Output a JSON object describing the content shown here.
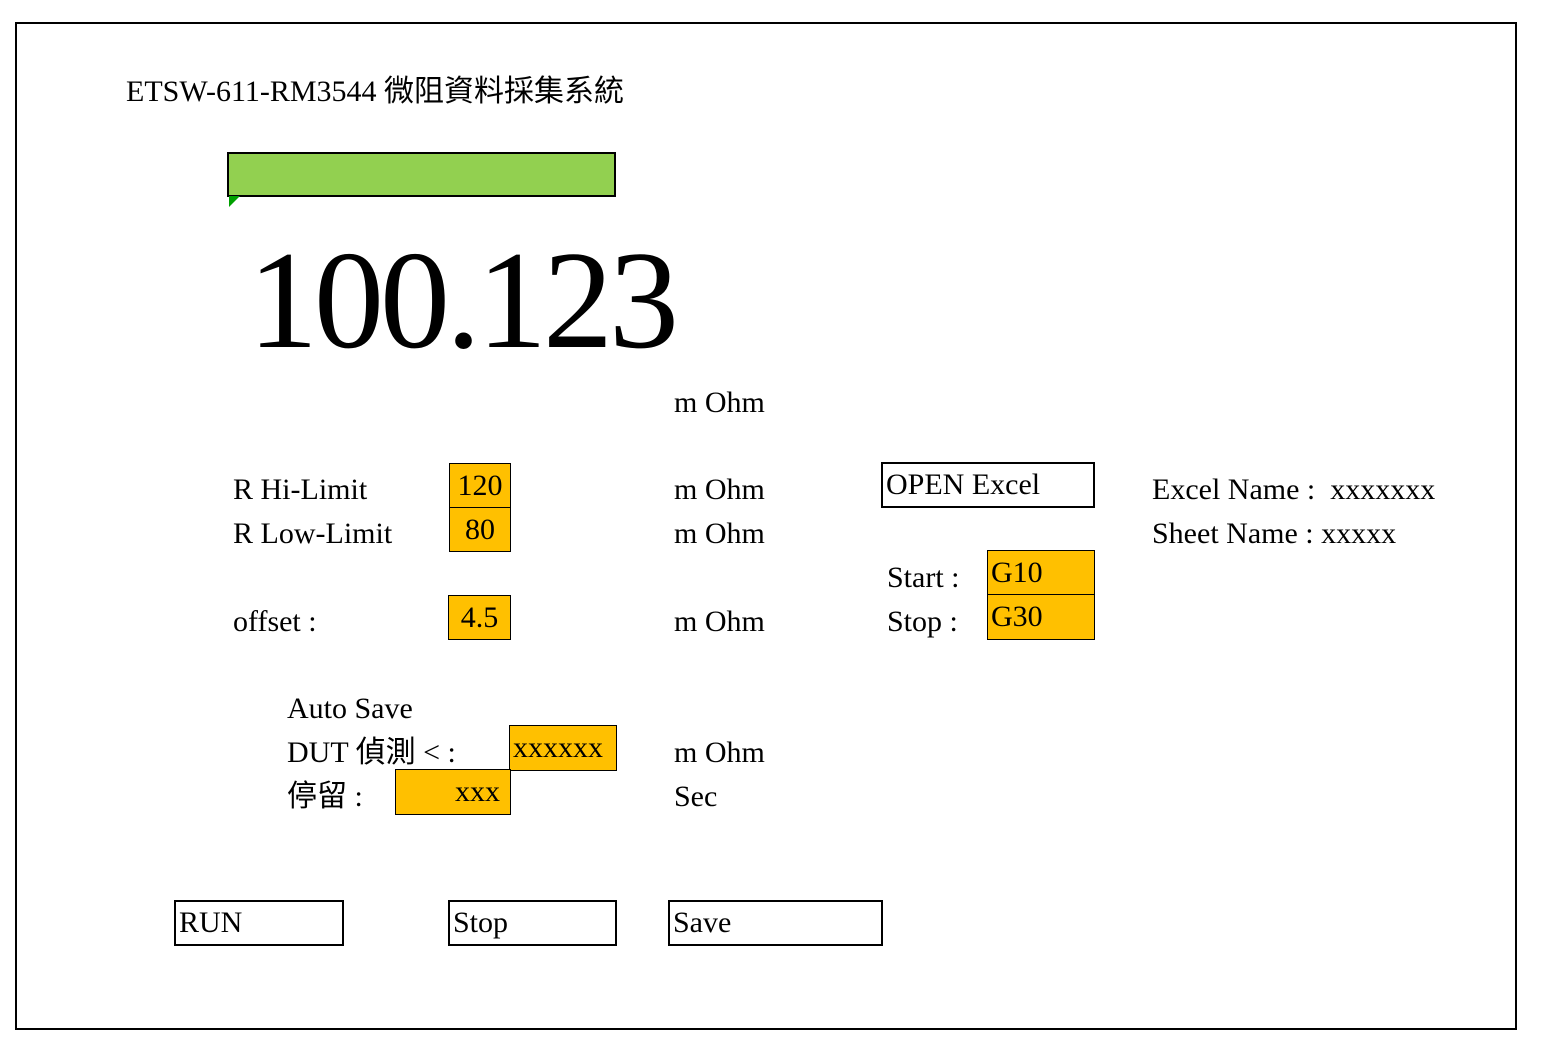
{
  "app": {
    "title": "ETSW-611-RM3544 微阻資料採集系統"
  },
  "colors": {
    "status_ok": "#92d050",
    "input_fill": "#ffc000",
    "indicator": "#00a000"
  },
  "measurement": {
    "value": "100.123",
    "unit": "m Ohm"
  },
  "limits": {
    "hi_label": "R Hi-Limit",
    "hi_value": "120",
    "hi_unit": "m Ohm",
    "low_label": "R Low-Limit",
    "low_value": "80",
    "low_unit": "m Ohm",
    "offset_label": "offset :",
    "offset_value": "4.5",
    "offset_unit": "m Ohm"
  },
  "excel": {
    "open_label": "OPEN Excel",
    "excel_name_label": "Excel Name :",
    "excel_name_value": "xxxxxxx",
    "sheet_name_label": "Sheet Name :",
    "sheet_name_value": "xxxxx",
    "start_label": "Start :",
    "start_value": "G10",
    "stop_label": "Stop :",
    "stop_value": "G30"
  },
  "autosave": {
    "heading": "Auto Save",
    "dut_label": "DUT 偵測 < :",
    "dut_value": "xxxxxx",
    "dut_unit": "m Ohm",
    "dwell_label": "停留 :",
    "dwell_value": "xxx",
    "dwell_unit": "Sec"
  },
  "buttons": {
    "run": "RUN",
    "stop": "Stop",
    "save": "Save"
  }
}
